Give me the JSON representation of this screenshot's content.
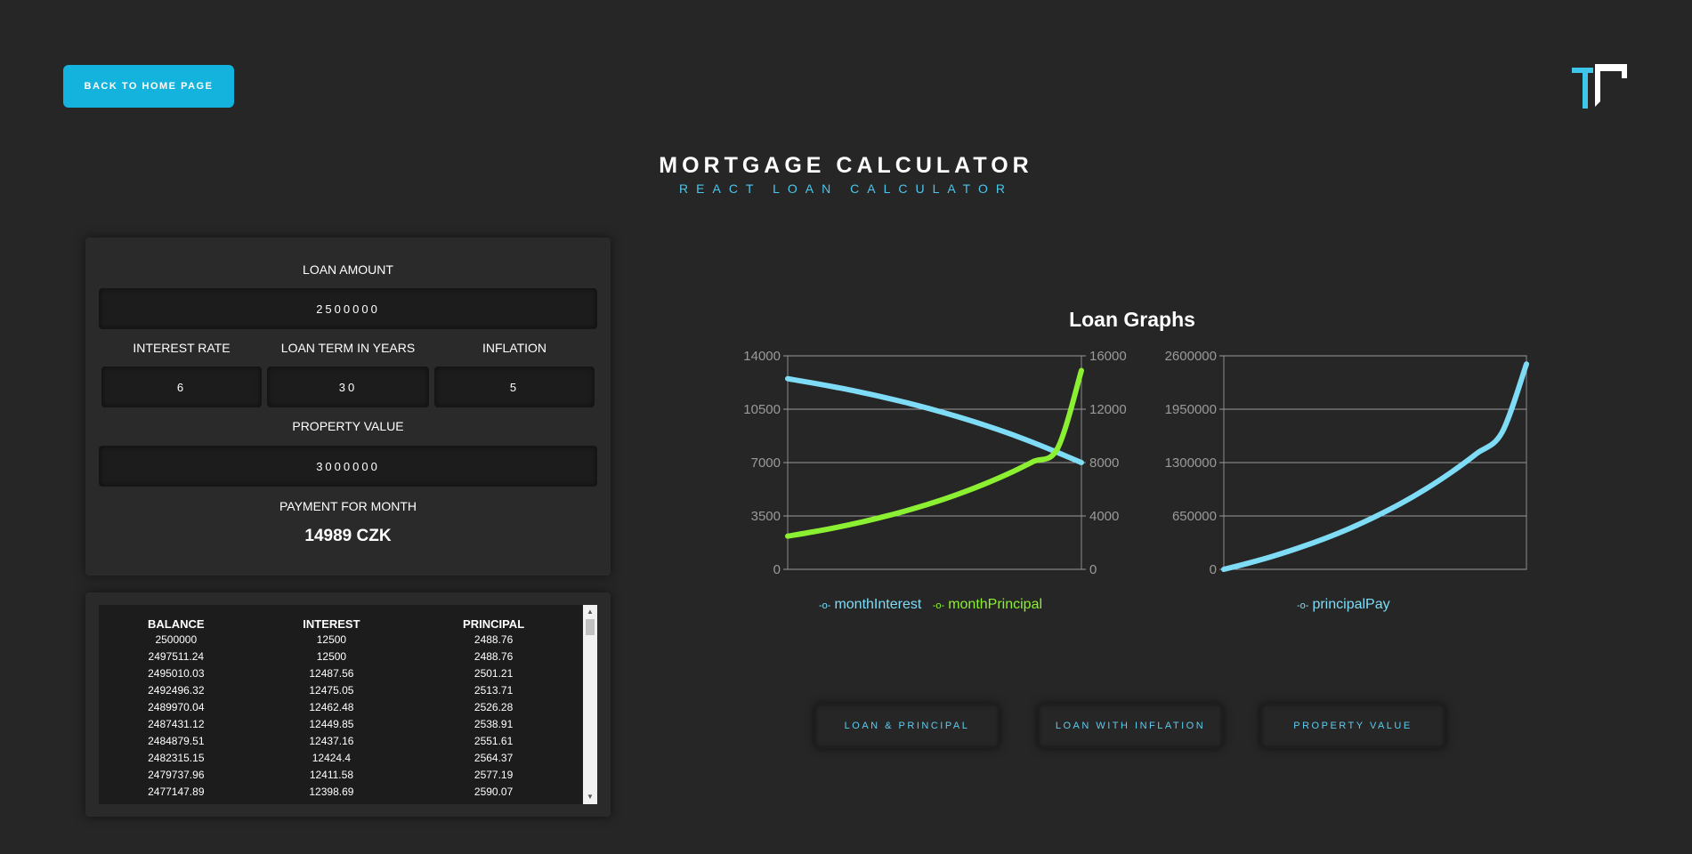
{
  "header": {
    "back_label": "BACK TO HOME PAGE",
    "title": "MORTGAGE CALCULATOR",
    "subtitle": "REACT LOAN CALCULATOR"
  },
  "form": {
    "loan_amount_label": "LOAN AMOUNT",
    "loan_amount_value": "2500000",
    "interest_rate_label": "INTEREST RATE",
    "interest_rate_value": "6",
    "loan_term_label": "LOAN TERM IN YEARS",
    "loan_term_value": "30",
    "inflation_label": "INFLATION",
    "inflation_value": "5",
    "property_value_label": "PROPERTY VALUE",
    "property_value_value": "3000000",
    "payment_label": "PAYMENT FOR MONTH",
    "payment_value": "14989 CZK"
  },
  "table": {
    "headers": [
      "BALANCE",
      "INTEREST",
      "PRINCIPAL"
    ],
    "rows": [
      [
        "2500000",
        "12500",
        "2488.76"
      ],
      [
        "2497511.24",
        "12500",
        "2488.76"
      ],
      [
        "2495010.03",
        "12487.56",
        "2501.21"
      ],
      [
        "2492496.32",
        "12475.05",
        "2513.71"
      ],
      [
        "2489970.04",
        "12462.48",
        "2526.28"
      ],
      [
        "2487431.12",
        "12449.85",
        "2538.91"
      ],
      [
        "2484879.51",
        "12437.16",
        "2551.61"
      ],
      [
        "2482315.15",
        "12424.4",
        "2564.37"
      ],
      [
        "2479737.96",
        "12411.58",
        "2577.19"
      ],
      [
        "2477147.89",
        "12398.69",
        "2590.07"
      ]
    ]
  },
  "graphs": {
    "title": "Loan Graphs",
    "buttons": [
      "LOAN & PRINCIPAL",
      "LOAN WITH INFLATION",
      "PROPERTY VALUE"
    ]
  },
  "colors": {
    "accent": "#14b3dd",
    "interest": "#7fdcf7",
    "principal": "#8cf032",
    "principal_pay": "#7fdcf7"
  },
  "chart_data": [
    {
      "type": "line",
      "title": "",
      "x": [
        0,
        30,
        60,
        90,
        120,
        150,
        180,
        210,
        240,
        270,
        300,
        330,
        359
      ],
      "left_axis": {
        "ylim": [
          0,
          14000
        ],
        "ticks": [
          "0",
          "3500",
          "7000",
          "10500",
          "14000"
        ]
      },
      "right_axis": {
        "ylim": [
          0,
          16000
        ],
        "ticks": [
          "0",
          "4000",
          "8000",
          "12000",
          "16000"
        ]
      },
      "series": [
        {
          "name": "monthInterest",
          "axis": "left",
          "values": [
            12500,
            12227,
            11929,
            11604,
            11249,
            10862,
            10438,
            9975,
            9470,
            8918,
            8315,
            7657,
            7000
          ]
        },
        {
          "name": "monthPrincipal",
          "axis": "right",
          "values": [
            2489,
            2798,
            3147,
            3541,
            3984,
            4481,
            5041,
            5670,
            6379,
            7176,
            8072,
            9080,
            14900
          ]
        }
      ],
      "grid": true,
      "legend": "bottom"
    },
    {
      "type": "line",
      "title": "",
      "x": [
        0,
        30,
        60,
        90,
        120,
        150,
        180,
        210,
        240,
        270,
        300,
        330,
        359
      ],
      "ylim": [
        0,
        2600000
      ],
      "ticks": [
        "0",
        "650000",
        "1300000",
        "1950000",
        "2600000"
      ],
      "series": [
        {
          "name": "principalPay",
          "values": [
            0,
            78000,
            166000,
            265000,
            376000,
            502000,
            643000,
            802000,
            981000,
            1183000,
            1410000,
            1666000,
            2500000
          ]
        }
      ],
      "grid": true,
      "legend": "bottom"
    }
  ]
}
